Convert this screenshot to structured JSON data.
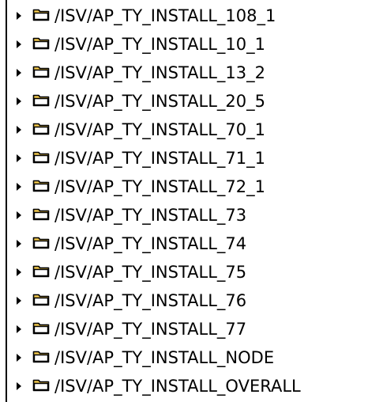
{
  "tree": {
    "expand_icon": "triangle-right-icon",
    "folder_icon": "folder-icon",
    "folder_color": "#f2c94c",
    "items": [
      {
        "label": "/ISV/AP_TY_INSTALL_108_1"
      },
      {
        "label": "/ISV/AP_TY_INSTALL_10_1"
      },
      {
        "label": "/ISV/AP_TY_INSTALL_13_2"
      },
      {
        "label": "/ISV/AP_TY_INSTALL_20_5"
      },
      {
        "label": "/ISV/AP_TY_INSTALL_70_1"
      },
      {
        "label": "/ISV/AP_TY_INSTALL_71_1"
      },
      {
        "label": "/ISV/AP_TY_INSTALL_72_1"
      },
      {
        "label": "/ISV/AP_TY_INSTALL_73"
      },
      {
        "label": "/ISV/AP_TY_INSTALL_74"
      },
      {
        "label": "/ISV/AP_TY_INSTALL_75"
      },
      {
        "label": "/ISV/AP_TY_INSTALL_76"
      },
      {
        "label": "/ISV/AP_TY_INSTALL_77"
      },
      {
        "label": "/ISV/AP_TY_INSTALL_NODE"
      },
      {
        "label": "/ISV/AP_TY_INSTALL_OVERALL"
      }
    ]
  }
}
